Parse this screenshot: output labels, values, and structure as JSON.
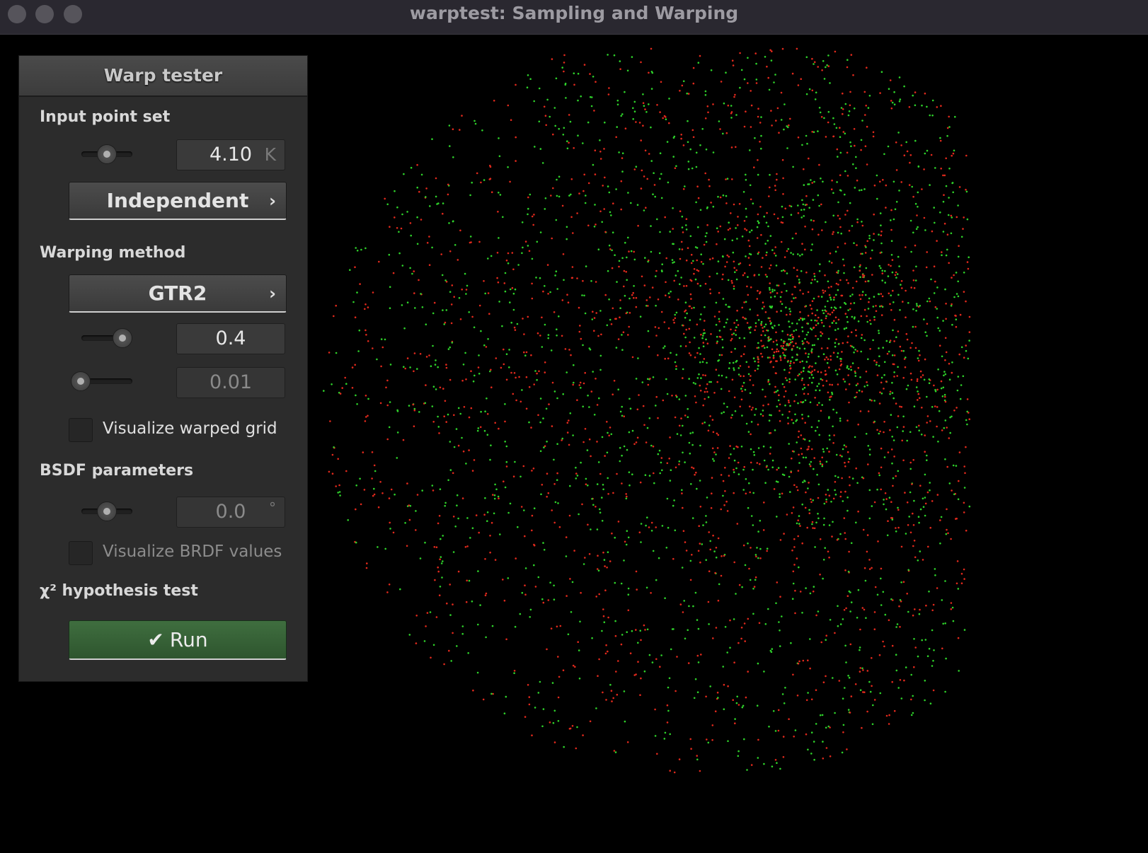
{
  "window": {
    "title": "warptest: Sampling and Warping"
  },
  "panel": {
    "title": "Warp tester",
    "input_point_set": {
      "label": "Input point set",
      "slider_level": 0.5,
      "count_value": "4.10",
      "count_unit": "K",
      "sampler": "Independent"
    },
    "warping_method": {
      "label": "Warping method",
      "method": "GTR2",
      "param1_slider_level": 0.75,
      "param1_value": "0.4",
      "param2_slider_level": 0.0,
      "param2_value": "0.01",
      "visualize_grid_label": "Visualize warped grid",
      "visualize_grid_checked": false
    },
    "bsdf_parameters": {
      "label": "BSDF parameters",
      "angle_slider_level": 0.5,
      "angle_value": "0.0",
      "angle_unit": "°",
      "visualize_brdf_label": "Visualize BRDF values",
      "visualize_brdf_checked": false
    },
    "hypothesis_test": {
      "label": "χ² hypothesis test",
      "run_label": "Run"
    }
  },
  "scatter": {
    "point_colors": [
      "#e0291c",
      "#2ed12a"
    ],
    "background": "#000000"
  },
  "icons": {
    "chevron": "chevron-right-icon",
    "run": "checkmark-icon"
  }
}
